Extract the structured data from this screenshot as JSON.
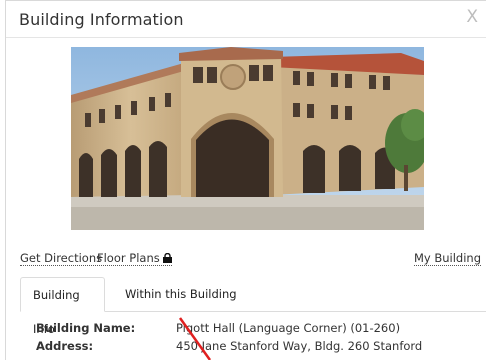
{
  "dialog": {
    "title": "Building Information",
    "close_label": "X"
  },
  "links": {
    "get_directions": "Get Directions",
    "floor_plans": "Floor Plans",
    "my_building": "My Building"
  },
  "tabs": [
    {
      "label": "Building Info",
      "active": true
    },
    {
      "label": "Within this Building",
      "active": false
    }
  ],
  "info": {
    "building_name_label": "Building Name:",
    "building_name_value": "Pigott Hall (Language Corner) (01-260)",
    "address_label": "Address:",
    "address_value": "450 Jane Stanford Way, Bldg. 260 Stanford"
  },
  "colors": {
    "accent_annotation": "#e02020",
    "sandstone": "#c9b08a",
    "roof": "#b5533a",
    "sky": "#a9c9e6"
  }
}
